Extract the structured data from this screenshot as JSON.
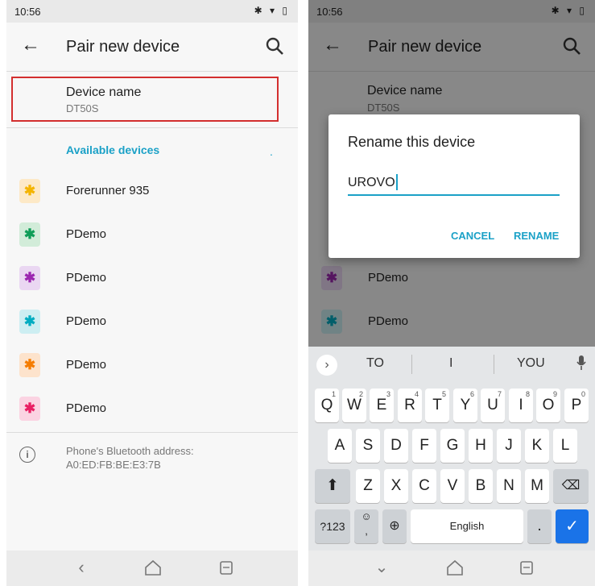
{
  "status": {
    "time": "10:56",
    "icons": "✱ ▾ ▯"
  },
  "toolbar": {
    "title": "Pair new device",
    "back_glyph": "←"
  },
  "device_name": {
    "label": "Device name",
    "value": "DT50S"
  },
  "available_header": "Available devices",
  "available_dot": ".",
  "devices": [
    {
      "name": "Forerunner 935",
      "color": "#f4b400"
    },
    {
      "name": "PDemo",
      "color": "#0f9d58"
    },
    {
      "name": "PDemo",
      "color": "#9c27b0"
    },
    {
      "name": "PDemo",
      "color": "#00acc1"
    },
    {
      "name": "PDemo",
      "color": "#f57c00"
    },
    {
      "name": "PDemo",
      "color": "#e91e63"
    }
  ],
  "bluetooth_address": {
    "label": "Phone's Bluetooth address:",
    "value": "A0:ED:FB:BE:E3:7B"
  },
  "dialog": {
    "title": "Rename this device",
    "input_value": "UROVO",
    "cancel": "CANCEL",
    "rename": "RENAME"
  },
  "keyboard": {
    "suggestions": [
      "TO",
      "I",
      "YOU"
    ],
    "row1": [
      "Q",
      "W",
      "E",
      "R",
      "T",
      "Y",
      "U",
      "I",
      "O",
      "P"
    ],
    "row1_digits": [
      "1",
      "2",
      "3",
      "4",
      "5",
      "6",
      "7",
      "8",
      "9",
      "0"
    ],
    "row2": [
      "A",
      "S",
      "D",
      "F",
      "G",
      "H",
      "J",
      "K",
      "L"
    ],
    "row3": [
      "Z",
      "X",
      "C",
      "V",
      "B",
      "N",
      "M"
    ],
    "symbols": "?123",
    "space": "English",
    "period": "."
  },
  "colors": {
    "accent": "#1ba1c7",
    "highlight": "#d32f2f",
    "enter": "#1a73e8"
  }
}
